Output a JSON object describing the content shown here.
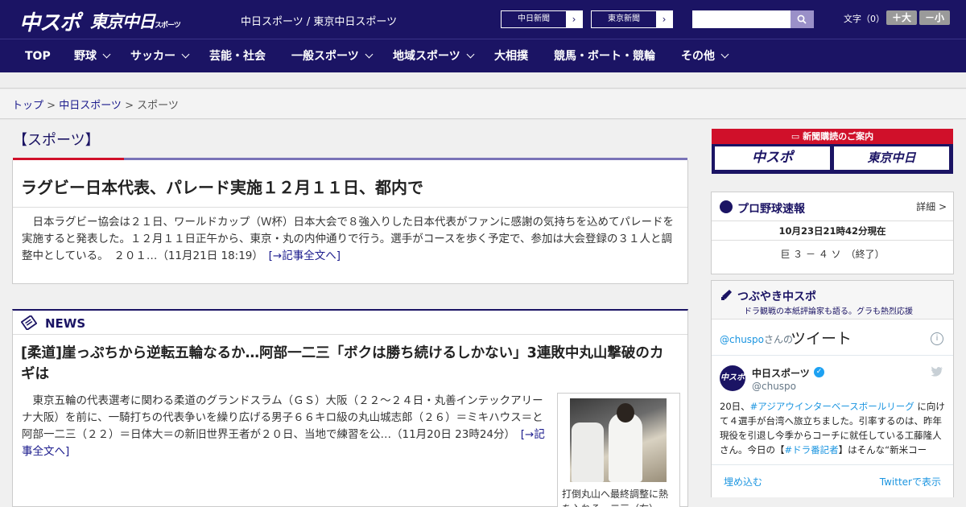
{
  "header": {
    "logo_chuspo": "中スポ",
    "logo_tokyo": "東京中日",
    "logo_tokyo_small": "スポーツ",
    "site_title": "中日スポーツ / 東京中日スポーツ",
    "ext_links": [
      "中日新聞",
      "東京新聞"
    ],
    "fontsize_label": "文字（0）",
    "fontsize_plus": "＋大",
    "fontsize_minus": "－小"
  },
  "nav": [
    {
      "label": "TOP",
      "dropdown": false
    },
    {
      "label": "野球",
      "dropdown": true
    },
    {
      "label": "サッカー",
      "dropdown": true
    },
    {
      "label": "芸能・社会",
      "dropdown": false
    },
    {
      "label": "一般スポーツ",
      "dropdown": true
    },
    {
      "label": "地域スポーツ",
      "dropdown": true
    },
    {
      "label": "大相撲",
      "dropdown": false
    },
    {
      "label": "競馬・ボート・競輪",
      "dropdown": false
    },
    {
      "label": "その他",
      "dropdown": true
    }
  ],
  "breadcrumb": {
    "top": "トップ",
    "sep": " > ",
    "chunichi": "中日スポーツ",
    "current": "スポーツ"
  },
  "section_title": "【スポーツ】",
  "lead": {
    "headline": "ラグビー日本代表、パレード実施１２月１１日、都内で",
    "body": "日本ラグビー協会は２１日、ワールドカップ（Ｗ杯）日本大会で８強入りした日本代表がファンに感謝の気持ちを込めてパレードを実施すると発表した。１２月１１日正午から、東京・丸の内仲通りで行う。選手がコースを歩く予定で、参加は大会登録の３１人と調整中としている。　２０１…（11月21日 18:19）　",
    "more": "[→記事全文へ]"
  },
  "news": {
    "label": "NEWS",
    "headline": "[柔道]崖っぷちから逆転五輪なるか…阿部一二三「ボクは勝ち続けるしかない」3連敗中丸山撃破のカギは",
    "body": "東京五輪の代表選考に関わる柔道のグランドスラム（ＧＳ）大阪（２２～２４日・丸善インテックアリーナ大阪）を前に、一騎打ちの代表争いを繰り広げる男子６６キロ級の丸山城志郎（２６）＝ミキハウス＝と阿部一二三（２２）＝日体大＝の新旧世界王者が２０日、当地で練習を公…（11月20日 23時24分）　",
    "more": "[→記事全文へ]",
    "caption": "打倒丸山へ最終調整に熱を入れる一二三（右）"
  },
  "sidebar": {
    "promo_head": "新聞購読のご案内",
    "promo_logo_a": "中スポ",
    "promo_logo_b": "東京中日",
    "baseball": {
      "title": "プロ野球速報",
      "detail": "詳細 >",
      "time": "10月23日21時42分現在",
      "score": "巨 ３ － ４ ソ　（終了）"
    },
    "twitter": {
      "title": "つぶやき中スポ",
      "subtitle": "ドラ観戦の本紙評論家も語る。グラも熱烈応援",
      "account": "@chuspo",
      "account_suffix": "さんの",
      "tweet_word": "ツイート",
      "name": "中日スポーツ",
      "handle": "@chuspo",
      "text_1": "20日、",
      "tag_1": "#アジアウインターベースボールリーグ",
      "text_2": " に向けて４選手が台湾へ旅立ちました。引率するのは、昨年現役を引退し今季からコーチに就任している工藤隆人さん。今日の【",
      "tag_2": "#ドラ番記者",
      "text_3": "】はそんな“新米コーチ”の奮闘ぶりをお伝えします。",
      "embed": "埋め込む",
      "view": "Twitterで表示"
    }
  },
  "colors": {
    "brand_navy": "#1b1464",
    "accent_red": "#d0102a",
    "link_blue": "#1a1a8c",
    "twitter_blue": "#1b95e0"
  }
}
